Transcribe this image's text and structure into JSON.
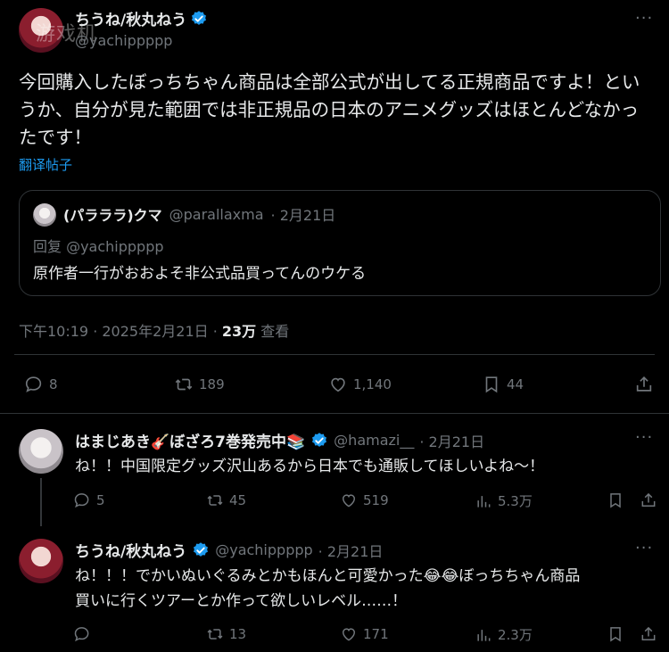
{
  "watermark": "游戏机",
  "main_tweet": {
    "display_name": "ちうね/秋丸ねう",
    "handle": "@yachippppp",
    "more": "···",
    "text": "今回購入したぼっちちゃん商品は全部公式が出してる正規商品ですよ！というか、自分が見た範囲では非正規品の日本のアニメグッズはほとんどなかったです！",
    "translate_link": "翻译帖子",
    "quote": {
      "display_name": "(パラララ)クマ",
      "handle": "@parallaxma",
      "date": "· 2月21日",
      "reply_to": "回复 @yachippppp",
      "text": "原作者一行がおおよそ非公式品買ってんのウケる"
    },
    "timestamp": "下午10:19 · 2025年2月21日 · ",
    "views_count": "23万",
    "views_label": " 查看",
    "stats": {
      "replies": "8",
      "retweets": "189",
      "likes": "1,140",
      "bookmarks": "44"
    }
  },
  "replies": [
    {
      "display_name": "はまじあき🎸ぼざろ7巻発売中📚",
      "handle": "@hamazi__",
      "date": "· 2月21日",
      "more": "···",
      "text": "ね！！中国限定グッズ沢山あるから日本でも通販してほしいよね〜！",
      "stats": {
        "replies": "5",
        "retweets": "45",
        "likes": "519",
        "views": "5.3万"
      }
    },
    {
      "display_name": "ちうね/秋丸ねう",
      "handle": "@yachippppp",
      "date": "· 2月21日",
      "more": "···",
      "text_line1": "ね！！！でかいぬいぐるみとかもほんと可愛かった😂😂ぼっちちゃん商品",
      "text_line2": "買いに行くツアーとか作って欲しいレベル……！",
      "stats": {
        "replies": "",
        "retweets": "13",
        "likes": "171",
        "views": "2.3万"
      }
    }
  ],
  "colors": {
    "background": "#000000",
    "text": "#e7e9ea",
    "muted": "#71767b",
    "link": "#1d9bf0",
    "verified": "#1d9bf0",
    "border": "#2f3336"
  }
}
